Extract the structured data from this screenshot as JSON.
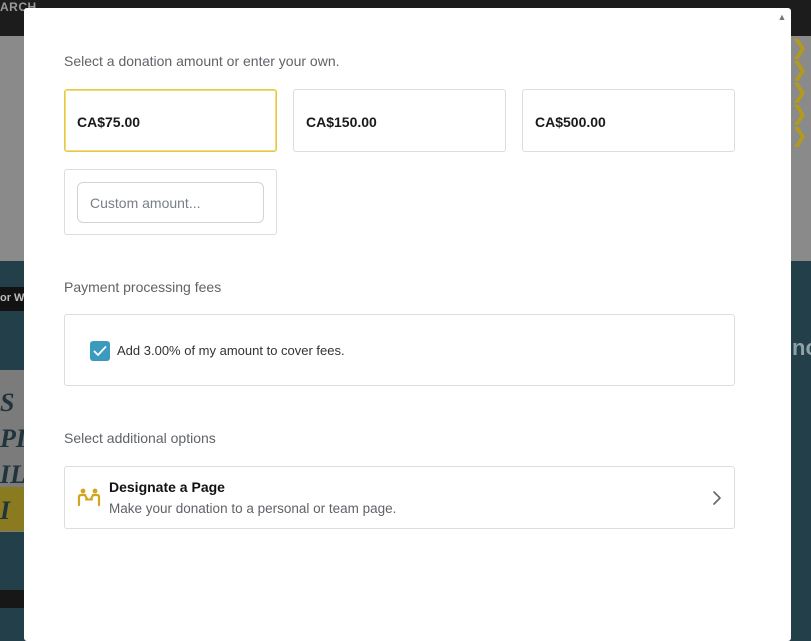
{
  "background": {
    "topbar_text": "ARCH",
    "pill_text": "or W",
    "poster_text": "S\nPI\nIL\nI",
    "right_text": "nc",
    "right_deco": "❯\n❯\n❯\n❯\n❯"
  },
  "modal": {
    "amount_prompt": "Select a donation amount or enter your own.",
    "amounts": [
      {
        "label": "CA$75.00",
        "selected": true
      },
      {
        "label": "CA$150.00",
        "selected": false
      },
      {
        "label": "CA$500.00",
        "selected": false
      }
    ],
    "custom_amount": {
      "value": "",
      "placeholder": "Custom amount..."
    },
    "fees": {
      "heading": "Payment processing fees",
      "checkbox_label": "Add 3.00% of my amount to cover fees.",
      "checked": true
    },
    "additional": {
      "heading": "Select additional options",
      "designate_title": "Designate a Page",
      "designate_subtitle": "Make your donation to a personal or team page.",
      "icon": "people-connect-icon"
    }
  },
  "colors": {
    "selected_border": "#e5c84a",
    "checkbox": "#3a9bbf",
    "icon_gold": "#d3a51c"
  }
}
